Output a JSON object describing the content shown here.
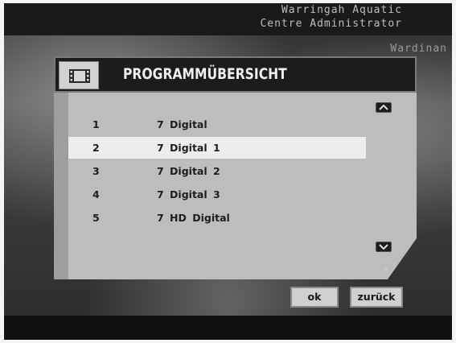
{
  "caption": {
    "line1": "Warringah Aquatic",
    "line2": "Centre Administrator",
    "line3": "Wardinan"
  },
  "dialog": {
    "title": "PROGRAMMÜBERSICHT",
    "title_icon": "tv-icon"
  },
  "channels": [
    {
      "number": "1",
      "name": "7 Digital"
    },
    {
      "number": "2",
      "name": "7 Digital 1",
      "selected": true
    },
    {
      "number": "3",
      "name": "7 Digital 2"
    },
    {
      "number": "4",
      "name": "7 Digital 3"
    },
    {
      "number": "5",
      "name": "7 HD Digital"
    }
  ],
  "buttons": {
    "ok": "ok",
    "back": "zurück"
  },
  "corner_glyph": "ᵃ",
  "colors": {
    "panel": "#bdbdbd",
    "selected_row": "#ededed",
    "titlebar": "#1c1c1c"
  }
}
